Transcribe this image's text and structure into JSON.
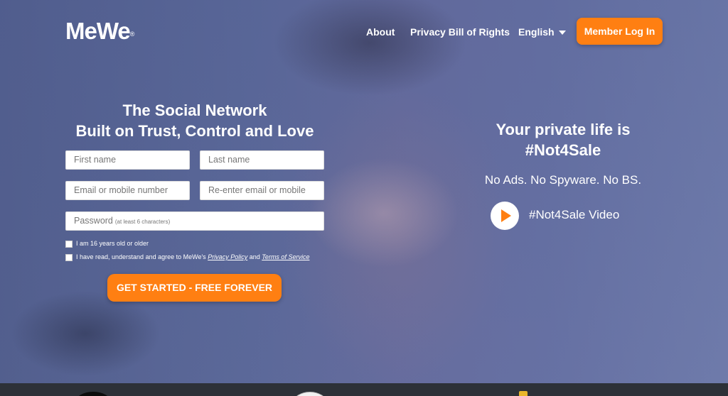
{
  "header": {
    "logo": "MeWe",
    "logo_mark": "®",
    "nav": {
      "about": "About",
      "privacy": "Privacy Bill of Rights",
      "language": "English"
    },
    "login_label": "Member Log In"
  },
  "signup": {
    "headline_line1": "The Social Network",
    "headline_line2": "Built on Trust, Control and Love",
    "first_name_placeholder": "First name",
    "last_name_placeholder": "Last name",
    "email_placeholder": "Email or mobile number",
    "reemail_placeholder": "Re-enter email or mobile",
    "password_placeholder": "Password",
    "password_hint": "(at least 6 characters)",
    "age_check_label": "I am 16 years old or older",
    "terms_prefix": "I have read, understand and agree to MeWe's",
    "privacy_policy_link": "Privacy Policy",
    "terms_and": "and",
    "terms_link": "Terms of Service",
    "cta_label": "GET STARTED - FREE FOREVER"
  },
  "promo": {
    "title_line1": "Your private life is",
    "title_line2": "#Not4Sale",
    "subtitle": "No Ads. No Spyware. No BS.",
    "video_label": "#Not4Sale Video"
  },
  "icons": {
    "play": "play-icon",
    "dropdown": "chevron-down-icon"
  },
  "colors": {
    "accent": "#ff7f12",
    "overlay": "#5e6b9b",
    "footer": "#2d3138"
  }
}
